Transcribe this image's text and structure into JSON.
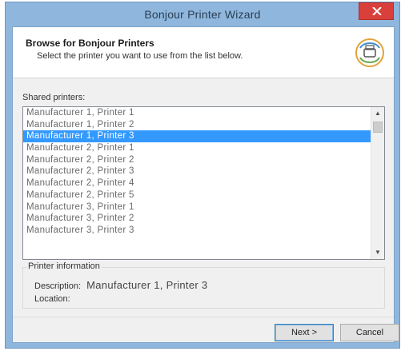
{
  "window": {
    "title": "Bonjour Printer Wizard"
  },
  "header": {
    "title": "Browse for Bonjour Printers",
    "subtitle": "Select the printer you want to use from the list below."
  },
  "shared_printers": {
    "label": "Shared printers:",
    "items": [
      {
        "label": "Manufacturer 1, Printer 1",
        "selected": false
      },
      {
        "label": "Manufacturer 1, Printer 2",
        "selected": false
      },
      {
        "label": "Manufacturer 1, Printer 3",
        "selected": true
      },
      {
        "label": "Manufacturer 2, Printer 1",
        "selected": false
      },
      {
        "label": "Manufacturer 2, Printer 2",
        "selected": false
      },
      {
        "label": "Manufacturer 2, Printer 3",
        "selected": false
      },
      {
        "label": "Manufacturer 2, Printer 4",
        "selected": false
      },
      {
        "label": "Manufacturer 2, Printer 5",
        "selected": false
      },
      {
        "label": "Manufacturer 3, Printer 1",
        "selected": false
      },
      {
        "label": "Manufacturer 3, Printer 2",
        "selected": false
      },
      {
        "label": "Manufacturer 3, Printer 3",
        "selected": false
      }
    ]
  },
  "printer_info": {
    "title": "Printer information",
    "description_label": "Description:",
    "description_value": "Manufacturer 1, Printer 3",
    "location_label": "Location:"
  },
  "buttons": {
    "next": "Next >",
    "cancel": "Cancel"
  },
  "icons": {
    "close": "close-icon",
    "logo": "bonjour-printer-logo"
  },
  "colors": {
    "titlebar": "#8fb7dd",
    "close": "#d9403b",
    "selection": "#3399ff"
  }
}
